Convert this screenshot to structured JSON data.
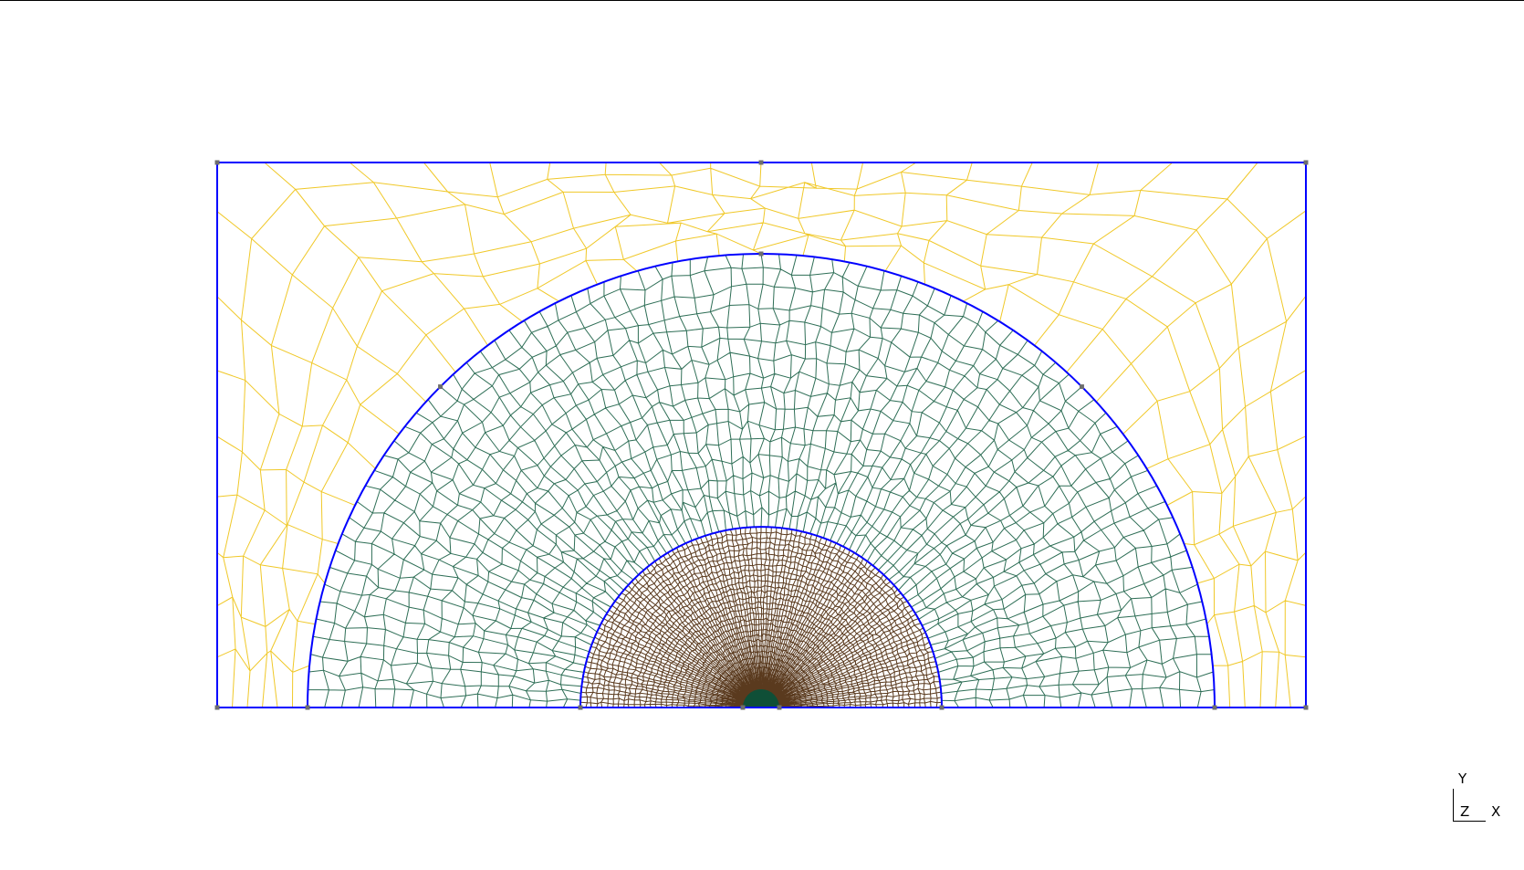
{
  "colors": {
    "background": "#ffffff",
    "boundary": "#0000ff",
    "vertex": "#6e6e6e",
    "outer_mesh": "#f0c828",
    "middle_mesh": "#2e6e56",
    "inner_mesh": "#5a3a1e",
    "core_fill": "#0f4f37"
  },
  "axis_triad": {
    "y_label": "Y",
    "z_label": "Z",
    "x_label": "X"
  }
}
